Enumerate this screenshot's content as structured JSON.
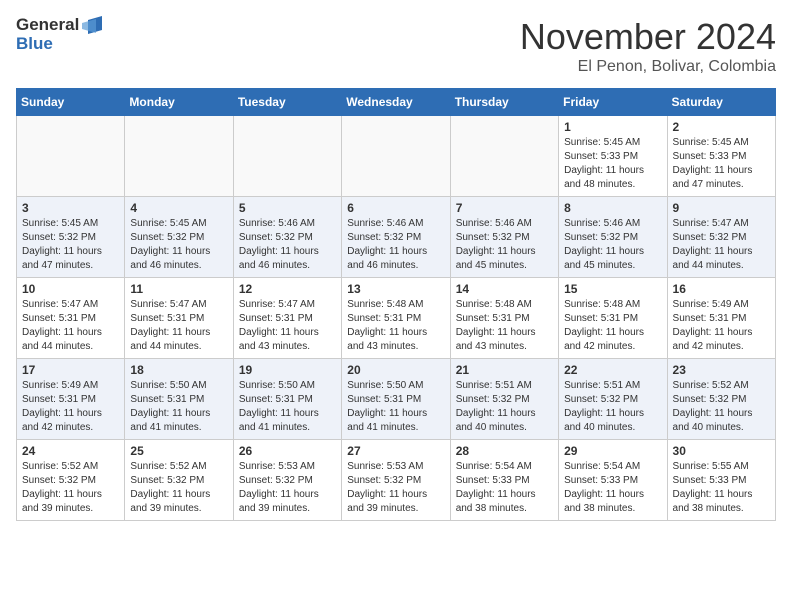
{
  "logo": {
    "general": "General",
    "blue": "Blue"
  },
  "header": {
    "month": "November 2024",
    "location": "El Penon, Bolivar, Colombia"
  },
  "weekdays": [
    "Sunday",
    "Monday",
    "Tuesday",
    "Wednesday",
    "Thursday",
    "Friday",
    "Saturday"
  ],
  "weeks": [
    [
      {
        "day": "",
        "sunrise": "",
        "sunset": "",
        "daylight": ""
      },
      {
        "day": "",
        "sunrise": "",
        "sunset": "",
        "daylight": ""
      },
      {
        "day": "",
        "sunrise": "",
        "sunset": "",
        "daylight": ""
      },
      {
        "day": "",
        "sunrise": "",
        "sunset": "",
        "daylight": ""
      },
      {
        "day": "",
        "sunrise": "",
        "sunset": "",
        "daylight": ""
      },
      {
        "day": "1",
        "sunrise": "Sunrise: 5:45 AM",
        "sunset": "Sunset: 5:33 PM",
        "daylight": "Daylight: 11 hours and 48 minutes."
      },
      {
        "day": "2",
        "sunrise": "Sunrise: 5:45 AM",
        "sunset": "Sunset: 5:33 PM",
        "daylight": "Daylight: 11 hours and 47 minutes."
      }
    ],
    [
      {
        "day": "3",
        "sunrise": "Sunrise: 5:45 AM",
        "sunset": "Sunset: 5:32 PM",
        "daylight": "Daylight: 11 hours and 47 minutes."
      },
      {
        "day": "4",
        "sunrise": "Sunrise: 5:45 AM",
        "sunset": "Sunset: 5:32 PM",
        "daylight": "Daylight: 11 hours and 46 minutes."
      },
      {
        "day": "5",
        "sunrise": "Sunrise: 5:46 AM",
        "sunset": "Sunset: 5:32 PM",
        "daylight": "Daylight: 11 hours and 46 minutes."
      },
      {
        "day": "6",
        "sunrise": "Sunrise: 5:46 AM",
        "sunset": "Sunset: 5:32 PM",
        "daylight": "Daylight: 11 hours and 46 minutes."
      },
      {
        "day": "7",
        "sunrise": "Sunrise: 5:46 AM",
        "sunset": "Sunset: 5:32 PM",
        "daylight": "Daylight: 11 hours and 45 minutes."
      },
      {
        "day": "8",
        "sunrise": "Sunrise: 5:46 AM",
        "sunset": "Sunset: 5:32 PM",
        "daylight": "Daylight: 11 hours and 45 minutes."
      },
      {
        "day": "9",
        "sunrise": "Sunrise: 5:47 AM",
        "sunset": "Sunset: 5:32 PM",
        "daylight": "Daylight: 11 hours and 44 minutes."
      }
    ],
    [
      {
        "day": "10",
        "sunrise": "Sunrise: 5:47 AM",
        "sunset": "Sunset: 5:31 PM",
        "daylight": "Daylight: 11 hours and 44 minutes."
      },
      {
        "day": "11",
        "sunrise": "Sunrise: 5:47 AM",
        "sunset": "Sunset: 5:31 PM",
        "daylight": "Daylight: 11 hours and 44 minutes."
      },
      {
        "day": "12",
        "sunrise": "Sunrise: 5:47 AM",
        "sunset": "Sunset: 5:31 PM",
        "daylight": "Daylight: 11 hours and 43 minutes."
      },
      {
        "day": "13",
        "sunrise": "Sunrise: 5:48 AM",
        "sunset": "Sunset: 5:31 PM",
        "daylight": "Daylight: 11 hours and 43 minutes."
      },
      {
        "day": "14",
        "sunrise": "Sunrise: 5:48 AM",
        "sunset": "Sunset: 5:31 PM",
        "daylight": "Daylight: 11 hours and 43 minutes."
      },
      {
        "day": "15",
        "sunrise": "Sunrise: 5:48 AM",
        "sunset": "Sunset: 5:31 PM",
        "daylight": "Daylight: 11 hours and 42 minutes."
      },
      {
        "day": "16",
        "sunrise": "Sunrise: 5:49 AM",
        "sunset": "Sunset: 5:31 PM",
        "daylight": "Daylight: 11 hours and 42 minutes."
      }
    ],
    [
      {
        "day": "17",
        "sunrise": "Sunrise: 5:49 AM",
        "sunset": "Sunset: 5:31 PM",
        "daylight": "Daylight: 11 hours and 42 minutes."
      },
      {
        "day": "18",
        "sunrise": "Sunrise: 5:50 AM",
        "sunset": "Sunset: 5:31 PM",
        "daylight": "Daylight: 11 hours and 41 minutes."
      },
      {
        "day": "19",
        "sunrise": "Sunrise: 5:50 AM",
        "sunset": "Sunset: 5:31 PM",
        "daylight": "Daylight: 11 hours and 41 minutes."
      },
      {
        "day": "20",
        "sunrise": "Sunrise: 5:50 AM",
        "sunset": "Sunset: 5:31 PM",
        "daylight": "Daylight: 11 hours and 41 minutes."
      },
      {
        "day": "21",
        "sunrise": "Sunrise: 5:51 AM",
        "sunset": "Sunset: 5:32 PM",
        "daylight": "Daylight: 11 hours and 40 minutes."
      },
      {
        "day": "22",
        "sunrise": "Sunrise: 5:51 AM",
        "sunset": "Sunset: 5:32 PM",
        "daylight": "Daylight: 11 hours and 40 minutes."
      },
      {
        "day": "23",
        "sunrise": "Sunrise: 5:52 AM",
        "sunset": "Sunset: 5:32 PM",
        "daylight": "Daylight: 11 hours and 40 minutes."
      }
    ],
    [
      {
        "day": "24",
        "sunrise": "Sunrise: 5:52 AM",
        "sunset": "Sunset: 5:32 PM",
        "daylight": "Daylight: 11 hours and 39 minutes."
      },
      {
        "day": "25",
        "sunrise": "Sunrise: 5:52 AM",
        "sunset": "Sunset: 5:32 PM",
        "daylight": "Daylight: 11 hours and 39 minutes."
      },
      {
        "day": "26",
        "sunrise": "Sunrise: 5:53 AM",
        "sunset": "Sunset: 5:32 PM",
        "daylight": "Daylight: 11 hours and 39 minutes."
      },
      {
        "day": "27",
        "sunrise": "Sunrise: 5:53 AM",
        "sunset": "Sunset: 5:32 PM",
        "daylight": "Daylight: 11 hours and 39 minutes."
      },
      {
        "day": "28",
        "sunrise": "Sunrise: 5:54 AM",
        "sunset": "Sunset: 5:33 PM",
        "daylight": "Daylight: 11 hours and 38 minutes."
      },
      {
        "day": "29",
        "sunrise": "Sunrise: 5:54 AM",
        "sunset": "Sunset: 5:33 PM",
        "daylight": "Daylight: 11 hours and 38 minutes."
      },
      {
        "day": "30",
        "sunrise": "Sunrise: 5:55 AM",
        "sunset": "Sunset: 5:33 PM",
        "daylight": "Daylight: 11 hours and 38 minutes."
      }
    ]
  ]
}
